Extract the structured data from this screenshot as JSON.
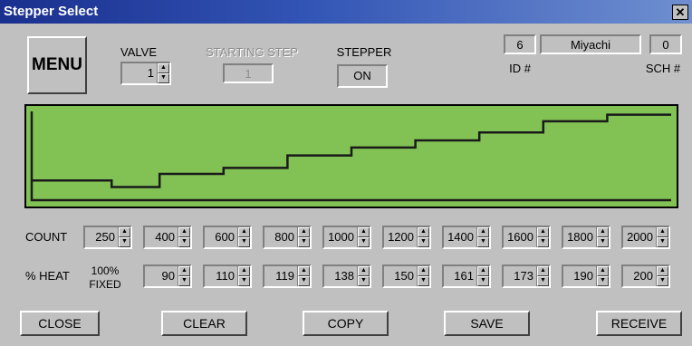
{
  "window": {
    "title": "Stepper Select",
    "close_glyph": "✕"
  },
  "menu_label": "MENU",
  "valve": {
    "label": "VALVE",
    "value": "1"
  },
  "starting_step": {
    "label": "STARTING STEP",
    "value": "1"
  },
  "stepper": {
    "label": "STEPPER",
    "state": "ON"
  },
  "id": {
    "value": "6",
    "label": "ID #"
  },
  "name": {
    "value": "Miyachi"
  },
  "sch": {
    "value": "0",
    "label": "SCH #"
  },
  "count": {
    "label": "COUNT",
    "values": [
      "250",
      "400",
      "600",
      "800",
      "1000",
      "1200",
      "1400",
      "1600",
      "1800",
      "2000"
    ]
  },
  "heat": {
    "label": "% HEAT",
    "fixed_label": "100%\nFIXED",
    "values": [
      "90",
      "110",
      "119",
      "138",
      "150",
      "161",
      "173",
      "190",
      "200"
    ]
  },
  "chart_data": {
    "type": "line",
    "x": [
      0,
      250,
      400,
      600,
      800,
      1000,
      1200,
      1400,
      1600,
      1800,
      2000
    ],
    "values": [
      100,
      90,
      110,
      119,
      138,
      150,
      161,
      173,
      190,
      200
    ],
    "line_color": "#1a1a1a",
    "background": "#82c154"
  },
  "buttons": {
    "close": "CLOSE",
    "clear": "CLEAR",
    "copy": "COPY",
    "save": "SAVE",
    "receive": "RECEIVE"
  }
}
